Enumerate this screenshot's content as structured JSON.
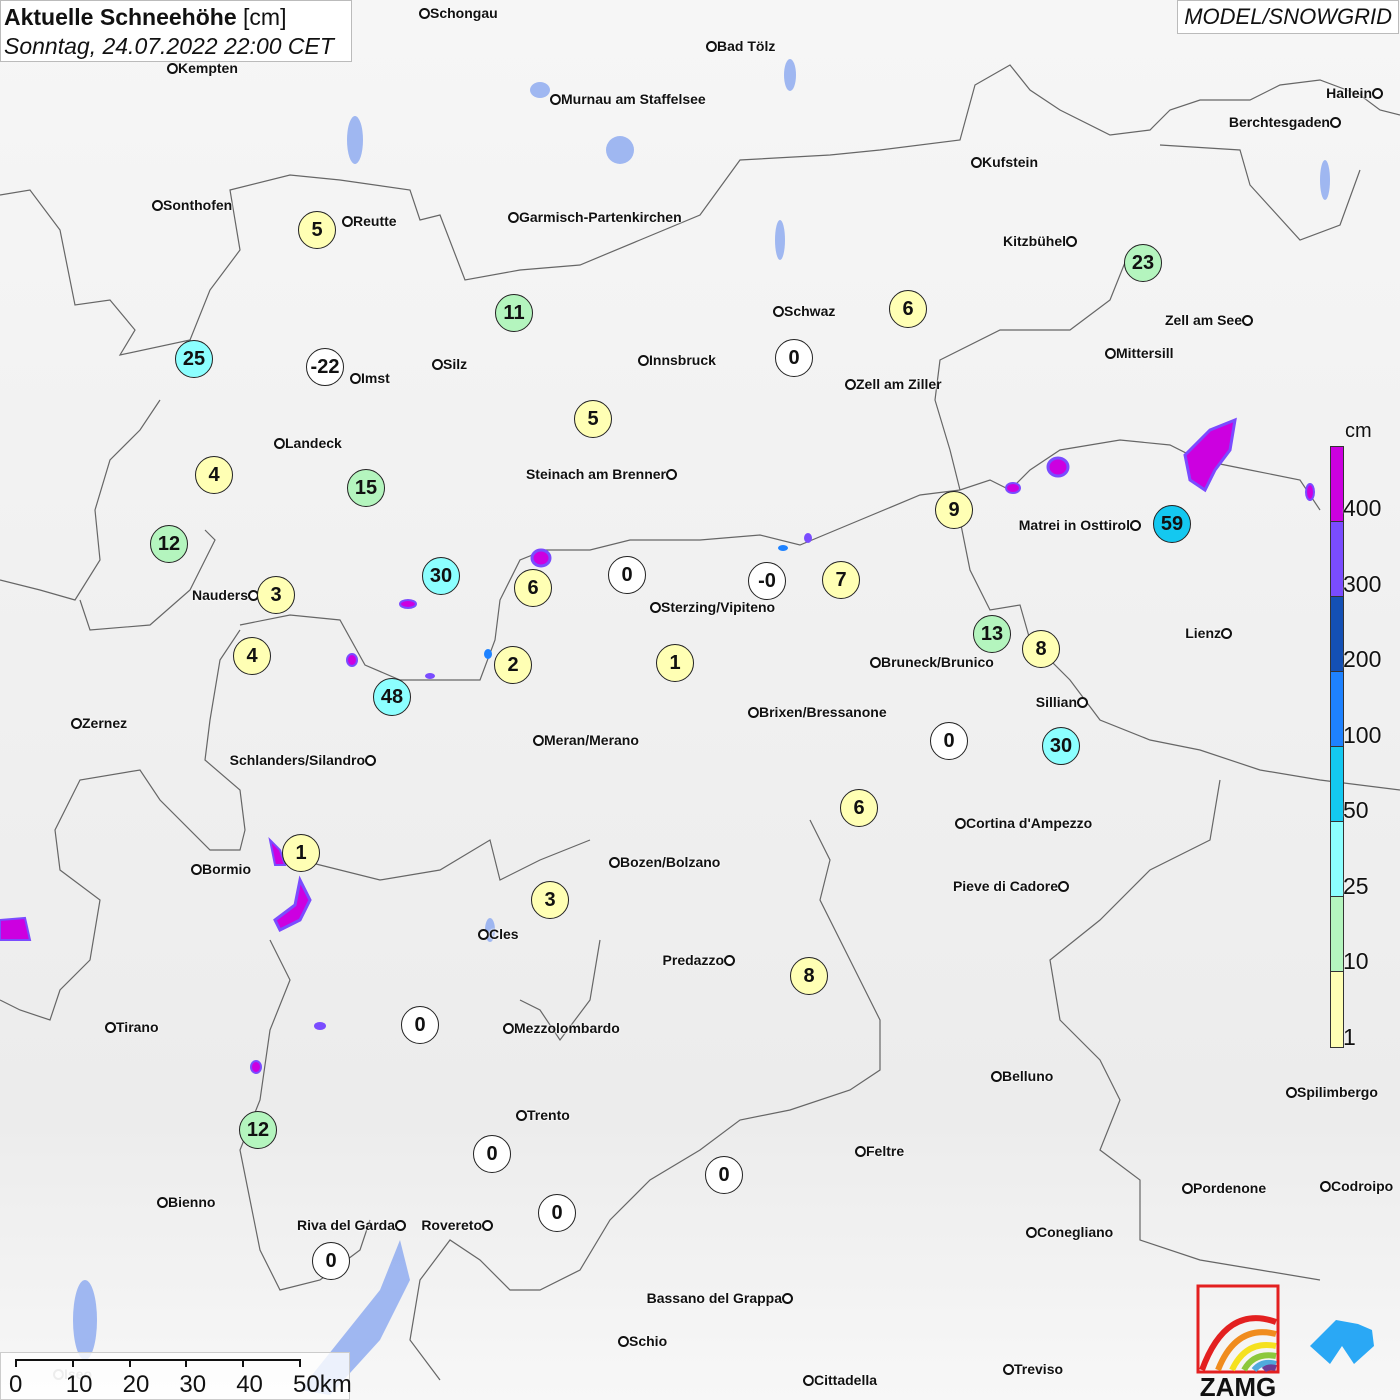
{
  "title": {
    "main": "Aktuelle Schneehöhe",
    "unit": "[cm]",
    "datetime": "Sonntag, 24.07.2022 22:00 CET"
  },
  "brand": "MODEL/SNOWGRID",
  "logo": {
    "text": "ZAMG"
  },
  "legend": {
    "unit": "cm",
    "labels": [
      "400",
      "300",
      "200",
      "100",
      "50",
      "25",
      "10",
      "1"
    ],
    "colors": [
      "#cc00e0",
      "#7a4cff",
      "#1450b4",
      "#1e82ff",
      "#14c8f0",
      "#8cffff",
      "#b4f5be",
      "#ffffb4"
    ]
  },
  "scale_bar": {
    "labels": [
      "0",
      "10",
      "20",
      "30",
      "40",
      "50km"
    ]
  },
  "cities": [
    "Schongau",
    "Bad Tölz",
    "Kempten",
    "Murnau am Staffelsee",
    "Hallein",
    "Berchtesgaden",
    "Kufstein",
    "Sonthofen",
    "Reutte",
    "Garmisch-Partenkirchen",
    "Kitzbühel",
    "Schwaz",
    "Zell am See",
    "Mittersill",
    "Innsbruck",
    "Silz",
    "Imst",
    "Zell am Ziller",
    "Landeck",
    "Steinach am Brenner",
    "Matrei in Osttirol",
    "Nauders",
    "Sterzing/Vipiteno",
    "Lienz",
    "Bruneck/Brunico",
    "Sillian",
    "Brixen/Bressanone",
    "Zernez",
    "Meran/Merano",
    "Schlanders/Silandro",
    "Cortina d'Ampezzo",
    "Bozen/Bolzano",
    "Bormio",
    "Pieve di Cadore",
    "Cles",
    "Predazzo",
    "Tirano",
    "Mezzolombardo",
    "Belluno",
    "Spilimbergo",
    "Trento",
    "Feltre",
    "Codroipo",
    "Pordenone",
    "Bienno",
    "Riva del Garda",
    "Rovereto",
    "Conegliano",
    "Bassano del Grappa",
    "Schio",
    "Treviso",
    "Cittadella",
    "Iseo"
  ],
  "snow_values": [
    "5",
    "11",
    "25",
    "-22",
    "4",
    "15",
    "12",
    "30",
    "6",
    "0",
    "-0",
    "7",
    "3",
    "4",
    "48",
    "2",
    "1",
    "5",
    "0",
    "6",
    "23",
    "9",
    "59",
    "13",
    "8",
    "0",
    "30",
    "6",
    "1",
    "3",
    "8",
    "0",
    "12",
    "0",
    "0",
    "0",
    "0"
  ],
  "colors": {
    "zero": "#ffffff",
    "c1": "#ffffb4",
    "c10": "#b4f5be",
    "c25": "#8cffff",
    "c50": "#14c8f0",
    "border": "#666666",
    "water": "#8aa8f0"
  }
}
